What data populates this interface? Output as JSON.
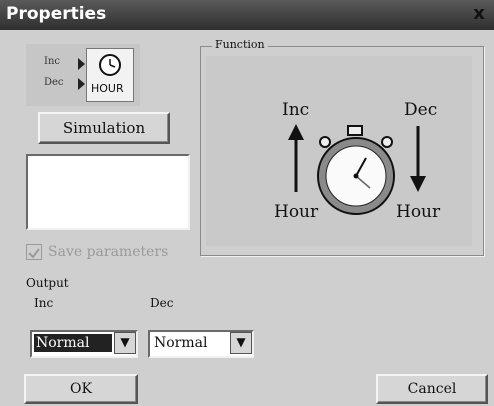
{
  "window": {
    "title": "Properties",
    "close": "x"
  },
  "icon": {
    "inc": "Inc",
    "dec": "Dec",
    "hour": "HOUR"
  },
  "buttons": {
    "simulation": "Simulation",
    "ok": "OK",
    "cancel": "Cancel"
  },
  "checkbox": {
    "label": "Save parameters",
    "checked": true
  },
  "function": {
    "title": "Function",
    "inc_label": "Inc",
    "dec_label": "Dec",
    "hour_left": "Hour",
    "hour_right": "Hour"
  },
  "output": {
    "title": "Output",
    "inc_label": "Inc",
    "dec_label": "Dec",
    "inc_value": "Normal",
    "dec_value": "Normal"
  }
}
